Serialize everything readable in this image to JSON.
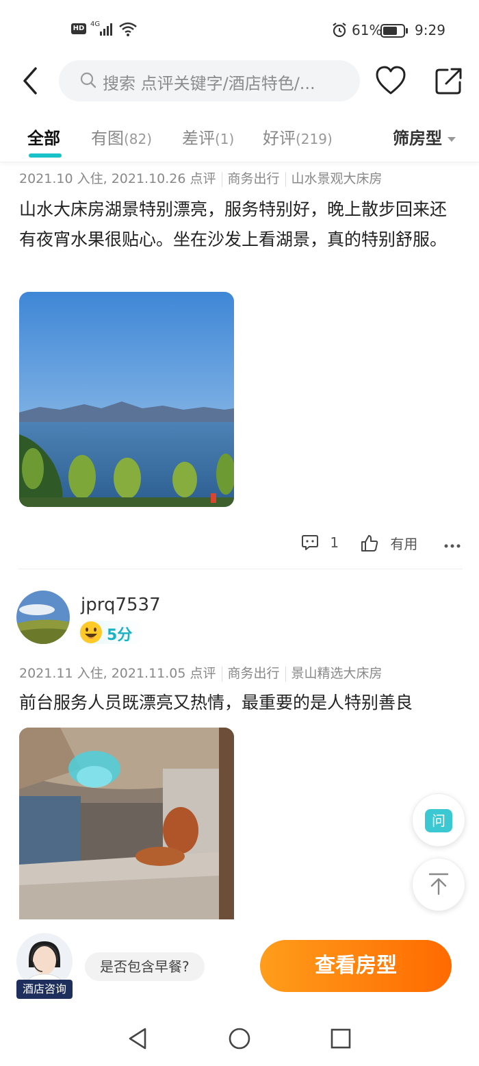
{
  "status_bar": {
    "left_icons": [
      "hd-icon",
      "4g-signal-icon",
      "wifi-icon"
    ],
    "battery": "61%",
    "time": "9:29"
  },
  "header": {
    "search_placeholder": "搜索 点评关键字/酒店特色/..."
  },
  "tabs": [
    {
      "label": "全部",
      "count": ""
    },
    {
      "label": "有图",
      "count": "(82)"
    },
    {
      "label": "差评",
      "count": "(1)"
    },
    {
      "label": "好评",
      "count": "(219)"
    }
  ],
  "filter_label": "筛房型",
  "reviews": [
    {
      "meta_date": "2021.10 入住, 2021.10.26 点评",
      "meta_trip": "商务出行",
      "meta_room": "山水景观大床房",
      "text": "山水大床房湖景特别漂亮，服务特别好，晚上散步回来还有夜宵水果很贴心。坐在沙发上看湖景，真的特别舒服。",
      "comment_count": "1",
      "useful_label": "有用"
    },
    {
      "username": "jprq7537",
      "score": "5分",
      "meta_date": "2021.11 入住, 2021.11.05 点评",
      "meta_trip": "商务出行",
      "meta_room": "景山精选大床房",
      "text": "前台服务人员既漂亮又热情，最重要的是人特别善良"
    }
  ],
  "fab": {
    "ask_label": "问"
  },
  "bottom": {
    "agent_label": "酒店咨询",
    "question_chip": "是否包含早餐?",
    "cta_label": "查看房型"
  },
  "colors": {
    "accent": "#19c1c9",
    "cta_start": "#ff9d1c",
    "cta_end": "#ff6a00"
  }
}
